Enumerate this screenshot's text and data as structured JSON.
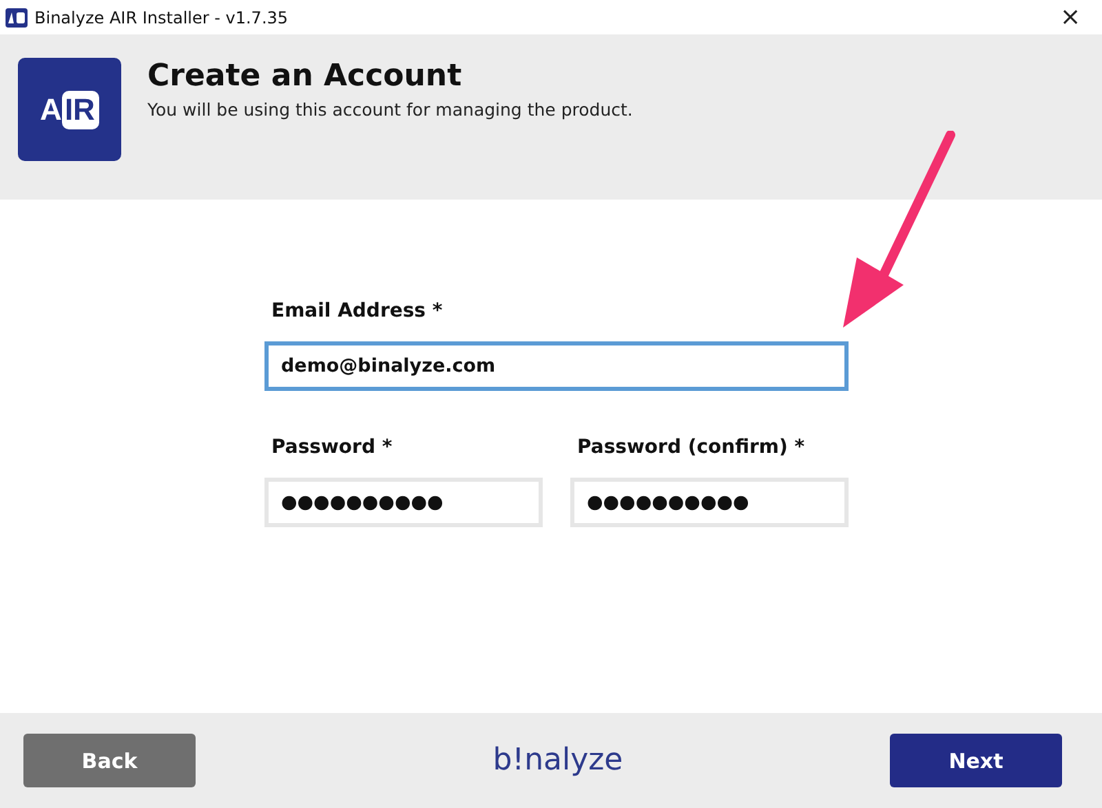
{
  "window": {
    "title": "Binalyze AIR Installer - v1.7.35",
    "close": "×"
  },
  "header": {
    "logo": {
      "left": "A",
      "right": "IR"
    },
    "title": "Create an Account",
    "subtitle": "You will be using this account for managing the product."
  },
  "form": {
    "fields": [
      {
        "label": "Email Address *",
        "value": "demo@binalyze.com",
        "focused": true
      },
      {
        "label": "Password *",
        "value": "●●●●●●●●●●",
        "focused": false
      },
      {
        "label": "Password (confirm) *",
        "value": "●●●●●●●●●●",
        "focused": false
      }
    ]
  },
  "footer": {
    "back": "Back",
    "brand": "b!nalyze",
    "next": "Next"
  }
}
